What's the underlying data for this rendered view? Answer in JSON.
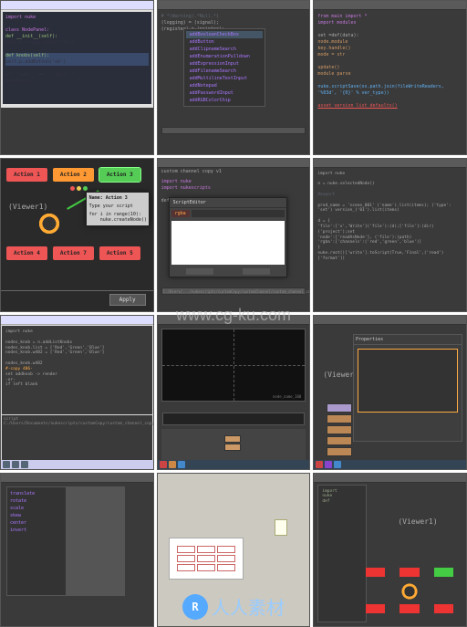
{
  "watermark_center": "www.cg-ku.com",
  "watermark_text": "人人素材",
  "panels": {
    "p1": {
      "code_lines": [
        "import nuke",
        "",
        "class NodePanel:",
        "    def __init__(self):",
        "        self.p = nuke.Panel('test')",
        "",
        "    def knobs(self):",
        "        self.p.addButton('ok')",
        "",
        "if __name__ == '__main__':",
        "    NodePanel()"
      ]
    },
    "p2": {
      "code_lines": [
        "# *(Warning).*Null.*{",
        "    (logging) = (signal);",
        "    (register) = (pointer);"
      ],
      "popup_items": [
        "addBooleanCheckBox",
        "addButton",
        "addClipnameSearch",
        "addEnumerationPulldown",
        "addExpressionInput",
        "addFilenameSearch",
        "addMultilineTextInput",
        "addNotepad",
        "addPasswordInput",
        "addRGBColorChip"
      ]
    },
    "p3": {
      "code_lines": [
        "from main import *",
        "import modules",
        "",
        "set =def(data):",
        "    node.module",
        "    key.handle()",
        "    mode = str",
        "",
        "    update()",
        "    module parse",
        "",
        "nuke.scriptSave(os.path.join(fileWriteReaders, '%03d', '{0}' % ver_type))",
        "",
        "asset_version_list_defaults()"
      ]
    },
    "p4": {
      "buttons_top": [
        "Action 1",
        "Action 2",
        "Action 3"
      ],
      "buttons_bottom": [
        "Action 4",
        "Action 7",
        "Action 5"
      ],
      "viewer": "(Viewer1)",
      "note_title": "Name: Action 3",
      "note_body": "Type your script",
      "note_code": "for i in range(10):\n    nuke.createNode()",
      "apply": "Apply"
    },
    "p5": {
      "code_tab": "custom channel copy v1",
      "code_lines": [
        "import nuke",
        "import nukescripts",
        "",
        "def customCopy():"
      ],
      "dialog_title": "ScriptEditor",
      "dialog_tab": "rgba",
      "input_line": "C:/Users/.../nukescripts/customCopy/customChannel/custom_channel_copy.py"
    },
    "p6": {
      "code_lines": [
        "import nuke",
        "",
        "n = nuke.selectedNode()",
        "",
        "#export",
        "",
        "prod_name = 'scene_001' ('name').list(items); ('type': 'set') version_('01').list(items)",
        "",
        "d = {",
        "  'file':['x','Write']('file'):(d);['file']:(dir)('project');set",
        "  'node':['readAsNode'],                ('file'):(path)",
        "  'rgba':['channels':('red','green','blue')]",
        "}",
        "nuke.root()['write'].toScript(True,'Final',('read')['format'])"
      ]
    },
    "p7": {
      "code_lines": [
        "import nuke",
        "",
        "nodes_knob = n.addListKnobs",
        "nodes_knob.list = ['Red','Green','Blue']",
        "nodes_knob.w482 = ['Red','Green','Blue']",
        "",
        "nodes_knob.w482",
        "#-copy 486-",
        "   set addknob -> render",
        " -or-",
        "   if left blank",
        "",
        "script C:/Users/Documents/nukescripts/customCopy/custom_channel_copy.py"
      ]
    },
    "p8": {
      "timeline_label": "node_name_100"
    },
    "p9": {
      "viewer": "(Viewer1)",
      "side_title": "Properties"
    },
    "p10": {
      "props": [
        "translate",
        "rotate",
        "scale",
        "skew",
        "center",
        "invert"
      ]
    },
    "p11": {
      "cell_value": ""
    },
    "p12": {
      "viewer": "(Viewer1)"
    }
  }
}
